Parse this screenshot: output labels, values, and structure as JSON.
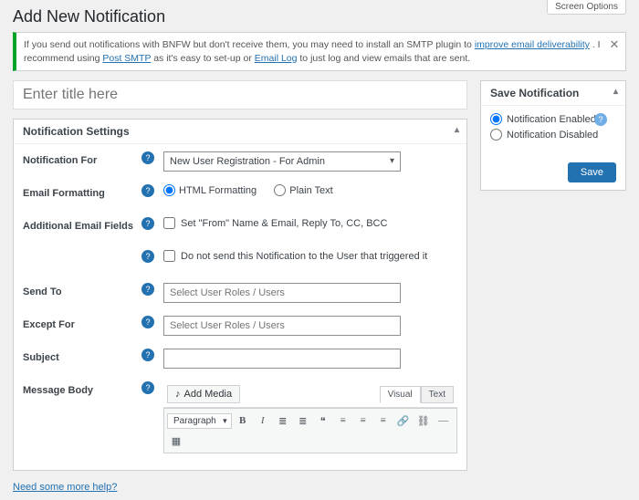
{
  "screen_options": "Screen Options",
  "page_title": "Add New Notification",
  "notice": {
    "prefix": "If you send out notifications with BNFW but don't receive them, you may need to install an SMTP plugin to ",
    "link1": "improve email deliverability",
    "mid": ". I recommend using ",
    "link2": "Post SMTP",
    "mid2": " as it's easy to set-up or ",
    "link3": "Email Log",
    "suffix": " to just log and view emails that are sent."
  },
  "title_placeholder": "Enter title here",
  "settings_box_title": "Notification Settings",
  "labels": {
    "notification_for": "Notification For",
    "email_formatting": "Email Formatting",
    "additional_fields": "Additional Email Fields",
    "send_to": "Send To",
    "except_for": "Except For",
    "subject": "Subject",
    "message_body": "Message Body"
  },
  "fields": {
    "notification_for_value": "New User Registration - For Admin",
    "fmt_html": "HTML Formatting",
    "fmt_plain": "Plain Text",
    "additional_cb1": "Set \"From\" Name & Email, Reply To, CC, BCC",
    "additional_cb2": "Do not send this Notification to the User that triggered it",
    "send_to_placeholder": "Select User Roles / Users",
    "except_for_placeholder": "Select User Roles / Users"
  },
  "editor": {
    "add_media": "Add Media",
    "tab_visual": "Visual",
    "tab_text": "Text",
    "format_select": "Paragraph",
    "buttons": [
      "B",
      "I",
      "≣",
      "≣",
      "❝",
      "≡",
      "≡",
      "≡",
      "🔗",
      "⛓",
      "—",
      "▦"
    ]
  },
  "help_link": "Need some more help?",
  "sidebar": {
    "box_title": "Save Notification",
    "opt_enabled": "Notification Enabled",
    "opt_disabled": "Notification Disabled",
    "save_btn": "Save"
  }
}
